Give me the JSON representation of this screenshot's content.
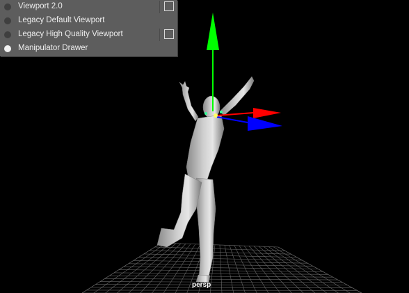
{
  "renderer_menu": {
    "items": [
      {
        "label": "Viewport 2.0",
        "selected": false,
        "has_options": true
      },
      {
        "label": "Legacy Default Viewport",
        "selected": false,
        "has_options": false
      },
      {
        "label": "Legacy High Quality Viewport",
        "selected": false,
        "has_options": true
      },
      {
        "label": "Manipulator Drawer",
        "selected": true,
        "has_options": false
      }
    ]
  },
  "viewport": {
    "camera_label": "persp",
    "background_color": "#000000",
    "grid_color": "#6f6f6f",
    "model_color": "#bdbdbd"
  },
  "manipulator": {
    "axes": [
      {
        "axis": "y",
        "color": "#00ff00"
      },
      {
        "axis": "x",
        "color": "#ff0000"
      },
      {
        "axis": "z",
        "color": "#0000ff"
      }
    ]
  }
}
